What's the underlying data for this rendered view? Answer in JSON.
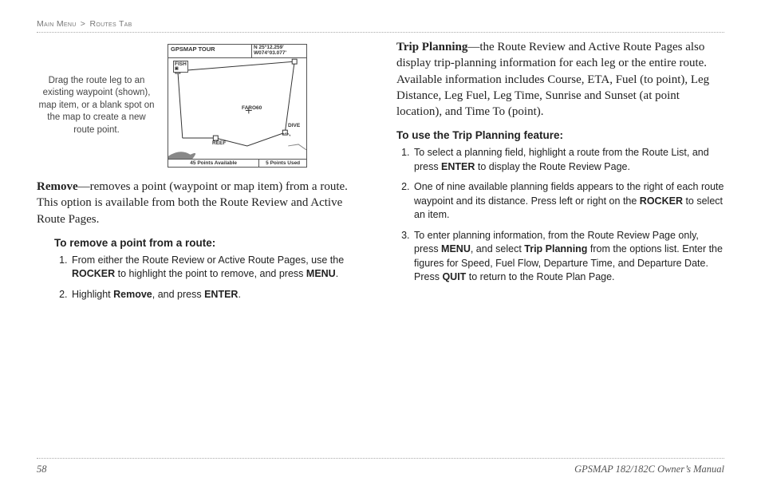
{
  "header": {
    "breadcrumb_a": "Main Menu",
    "sep": ">",
    "breadcrumb_b": "Routes Tab"
  },
  "figure": {
    "caption": "Drag the route leg to an existing waypoint (shown), map item, or a blank spot on the map to create a new route point.",
    "screen": {
      "title": "GPSMAP TOUR",
      "coord1": "N 25°12.259'",
      "coord2": "W074°03.077'",
      "wp_fish": "FISH",
      "wp_faro": "FARO60",
      "wp_dive": "DIVE",
      "wp_reef": "REEF",
      "status_left": "45 Points Available",
      "status_right": "5 Points Used"
    }
  },
  "left": {
    "remove_lead": "Remove",
    "remove_body": "—removes a point (waypoint or map item) from a route. This option is available from both the Route Review and Active Route Pages.",
    "remove_sub": "To remove a point from a route:",
    "steps": [
      {
        "pre": "From either the Route Review or Active Route Pages, use the ",
        "b1": "ROCKER",
        "mid1": " to highlight the point to remove, and press ",
        "b2": "MENU",
        "post": "."
      },
      {
        "pre": "Highlight ",
        "b1": "Remove",
        "mid1": ", and press ",
        "b2": "ENTER",
        "post": "."
      }
    ]
  },
  "right": {
    "trip_lead": "Trip Planning",
    "trip_body": "—the Route Review and Active Route Pages also display trip-planning information for each leg or the entire route. Available information includes Course, ETA, Fuel (to point), Leg Distance, Leg Fuel, Leg Time, Sunrise and Sunset (at point location), and Time To (point).",
    "trip_sub": "To use the Trip Planning feature:",
    "steps": [
      {
        "pre": "To select a planning field, highlight a route from the Route List, and press ",
        "b1": "ENTER",
        "mid1": " to display the Route Review Page.",
        "b2": "",
        "post": ""
      },
      {
        "pre": "One of nine available planning fields appears to the right of each route waypoint and its distance. Press left or right on the ",
        "b1": "ROCKER",
        "mid1": " to select an item.",
        "b2": "",
        "post": ""
      },
      {
        "pre": "To enter planning information, from the Route Review Page only, press ",
        "b1": "MENU",
        "mid1": ", and select ",
        "b2": "Trip Planning",
        "mid2": " from the options list. Enter the figures for Speed, Fuel Flow, Departure Time, and Departure Date. Press ",
        "b3": "QUIT",
        "post": " to return to the Route Plan Page."
      }
    ]
  },
  "footer": {
    "page": "58",
    "book": "GPSMAP 182/182C Owner’s Manual"
  }
}
